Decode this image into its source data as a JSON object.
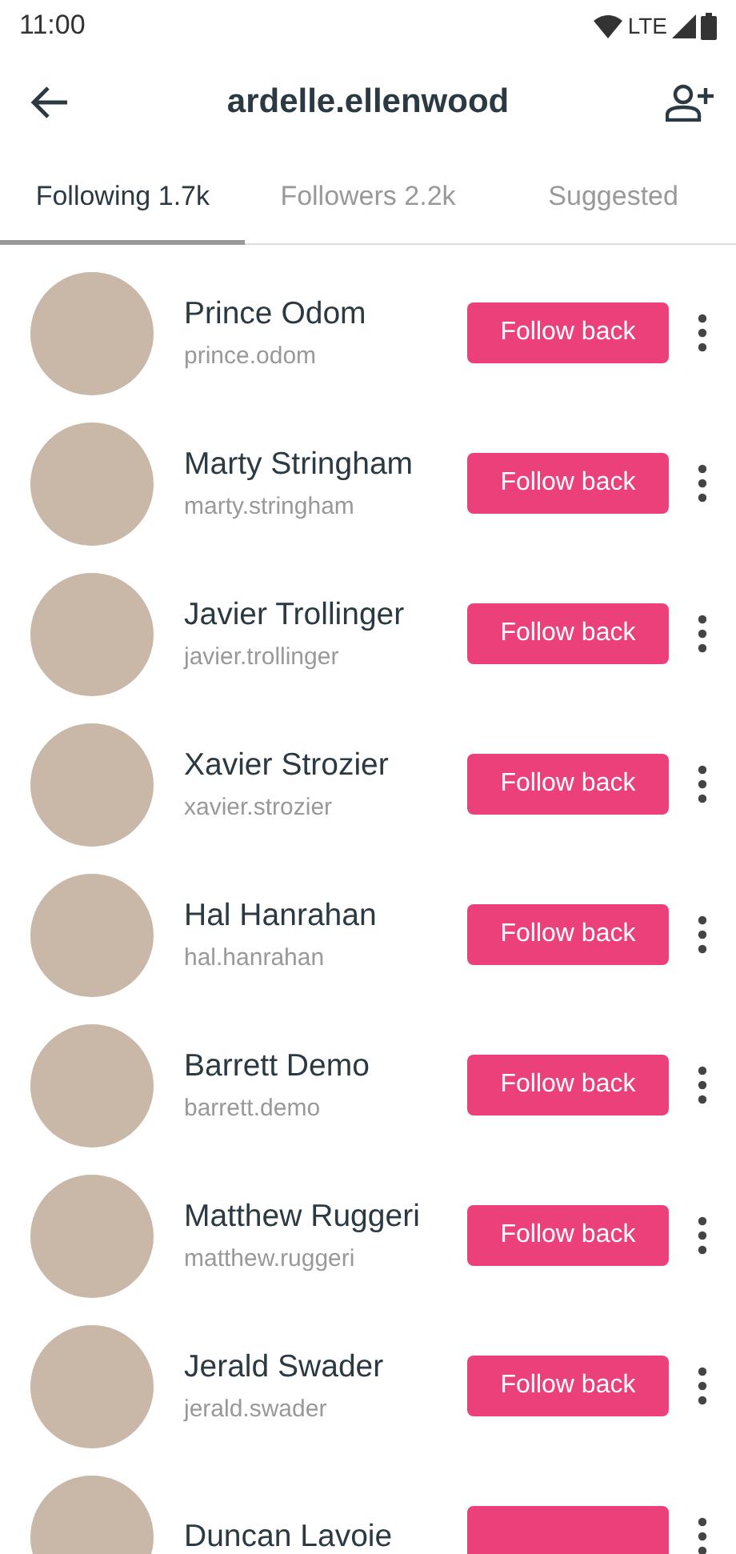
{
  "status_bar": {
    "time": "11:00",
    "network": "LTE"
  },
  "app_bar": {
    "title": "ardelle.ellenwood"
  },
  "tabs": [
    {
      "label": "Following 1.7k",
      "selected": true
    },
    {
      "label": "Followers 2.2k",
      "selected": false
    },
    {
      "label": "Suggested",
      "selected": false
    }
  ],
  "users": [
    {
      "name": "Prince Odom",
      "username": "prince.odom",
      "button": "Follow back"
    },
    {
      "name": "Marty Stringham",
      "username": "marty.stringham",
      "button": "Follow back"
    },
    {
      "name": "Javier Trollinger",
      "username": "javier.trollinger",
      "button": "Follow back"
    },
    {
      "name": "Xavier Strozier",
      "username": "xavier.strozier",
      "button": "Follow back"
    },
    {
      "name": "Hal Hanrahan",
      "username": "hal.hanrahan",
      "button": "Follow back"
    },
    {
      "name": "Barrett Demo",
      "username": "barrett.demo",
      "button": "Follow back"
    },
    {
      "name": "Matthew Ruggeri",
      "username": "matthew.ruggeri",
      "button": "Follow back"
    },
    {
      "name": "Jerald Swader",
      "username": "jerald.swader",
      "button": "Follow back"
    },
    {
      "name": "Duncan Lavoie"
    }
  ]
}
